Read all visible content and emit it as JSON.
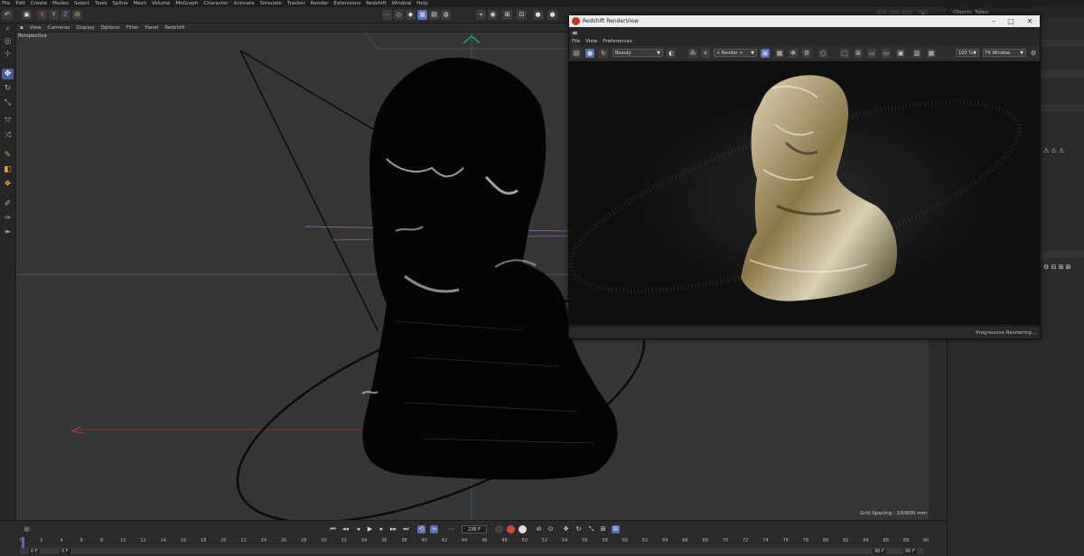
{
  "menubar": {
    "items": [
      "File",
      "Edit",
      "Create",
      "Modes",
      "Select",
      "Tools",
      "Spline",
      "Mesh",
      "Volume",
      "MoGraph",
      "Character",
      "Animate",
      "Simulate",
      "Tracker",
      "Render",
      "Extensions",
      "Redshift",
      "Window",
      "Help"
    ]
  },
  "toolbar": {
    "axis_x": "X",
    "axis_y": "Y",
    "axis_z": "Z"
  },
  "viewport": {
    "menu": [
      "View",
      "Cameras",
      "Display",
      "Options",
      "Filter",
      "Panel",
      "Redshift"
    ],
    "label": "Perspective",
    "grid_spacing": "Grid Spacing : 100000 mm"
  },
  "right_panel": {
    "tabs": [
      "Objects",
      "Takes"
    ]
  },
  "renderview": {
    "title": "Redshift RenderView",
    "menu": [
      "File",
      "View",
      "Preferences"
    ],
    "aov_dropdown": "Beauty",
    "camera_dropdown": "< Render >",
    "zoom_dropdown": "100 %",
    "fit_dropdown": "Fit Window",
    "status": "Progressive Rendering..."
  },
  "timeline": {
    "current_frame": "236 F",
    "start_field": "0 F",
    "min_field": "0 F",
    "max_field": "90 F",
    "end_field": "90 F",
    "ruler_labels": [
      "0",
      "2",
      "4",
      "6",
      "8",
      "10",
      "12",
      "14",
      "16",
      "18",
      "20",
      "22",
      "24",
      "26",
      "28",
      "30",
      "32",
      "34",
      "36",
      "38",
      "40",
      "42",
      "44",
      "46",
      "48",
      "50",
      "52",
      "54",
      "56",
      "58",
      "60",
      "62",
      "64",
      "66",
      "68",
      "70",
      "72",
      "74",
      "76",
      "78",
      "80",
      "82",
      "84",
      "86",
      "88",
      "90"
    ]
  },
  "colors": {
    "accent": "#5a6fb6",
    "record": "#d8453d"
  }
}
